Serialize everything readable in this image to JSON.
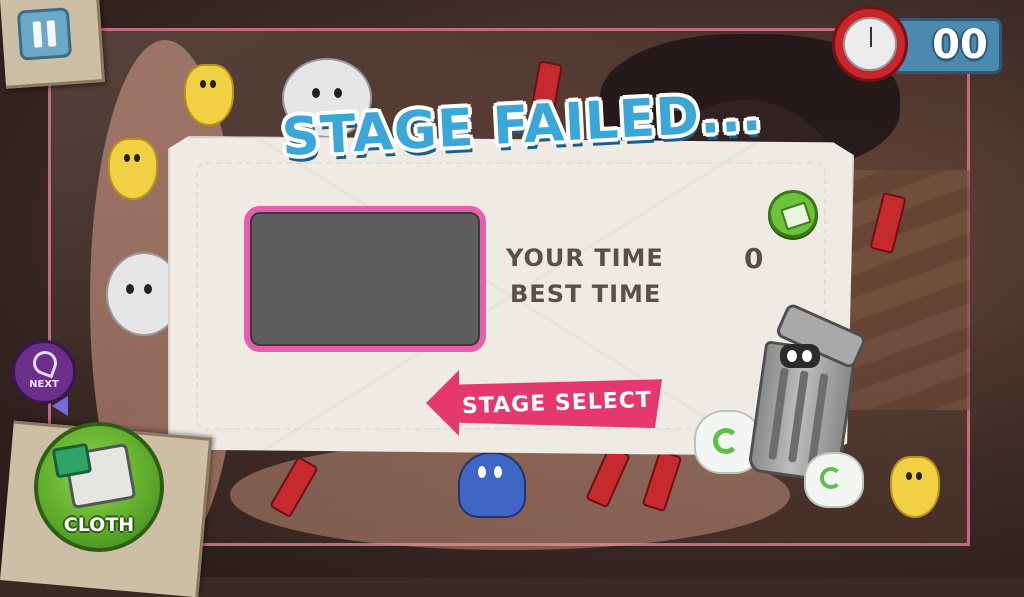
{
  "header": {
    "pause_icon": "pause-icon",
    "timer_icon": "stopwatch-icon",
    "timer_value": "00"
  },
  "dialog": {
    "title": "STAGE FAILED...",
    "your_time_label": "YOUR TIME",
    "your_time_value": "0",
    "best_time_label": "BEST TIME",
    "best_time_value": "",
    "share_icon": "money-share-icon",
    "stage_select_label": "STAGE SELECT"
  },
  "tools": {
    "next_label": "NEXT",
    "next_icon": "vacuum-icon",
    "cloth_label": "CLOTH",
    "cloth_icon": "cloth-bucket-icon",
    "trash_icon": "trash-can-icon",
    "recycle_icon": "recycle-icon"
  },
  "colors": {
    "title_blue": "#3aa7d8",
    "stage_select_pink": "#e5386e",
    "preview_border": "#e65fac",
    "cloth_green": "#5ca82a",
    "next_purple": "#6a2f8a"
  }
}
